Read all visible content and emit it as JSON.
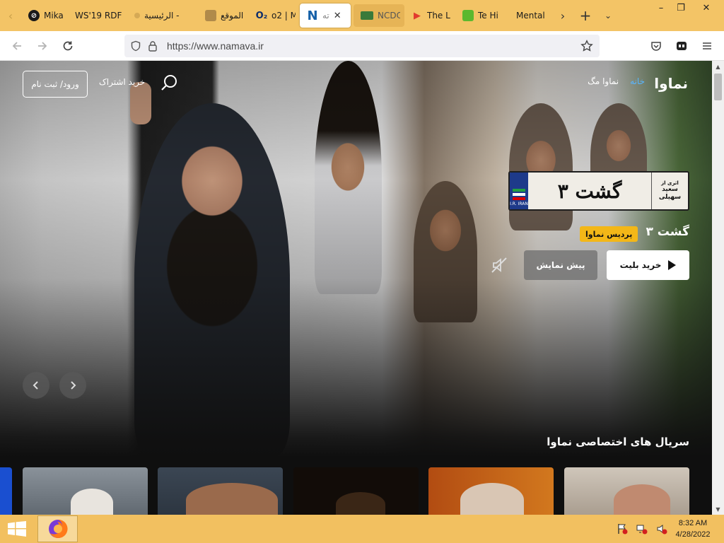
{
  "browser": {
    "tabs": [
      {
        "title": "Mikas",
        "favicon": "dark-circle-icon",
        "color": "#1a1a1a"
      },
      {
        "title": "WS'19 RDF",
        "favicon": "blank-icon",
        "color": "#f3c466"
      },
      {
        "title": "الرئيسية -",
        "favicon": "gray-dot-icon",
        "color": "#777777"
      },
      {
        "title": "الموقع",
        "favicon": "seal-icon",
        "color": "#8a6a3a"
      },
      {
        "title": "o2 | M",
        "favicon": "o2-icon",
        "color": "#0d2d6b"
      },
      {
        "title": "ته",
        "favicon": "namava-n-icon",
        "color": "#1560a8",
        "active": true
      },
      {
        "title": "NCDC",
        "favicon": "ncdc-icon",
        "color": "#3a7a3a",
        "highlight": true
      },
      {
        "title": "The L",
        "favicon": "play-red-icon",
        "color": "#e23b2e"
      },
      {
        "title": "Te Hi",
        "favicon": "green-leaf-icon",
        "color": "#5cb82e"
      },
      {
        "title": "Mental",
        "favicon": "none",
        "color": ""
      }
    ],
    "window_controls": {
      "minimize": "–",
      "restore": "❐",
      "close": "✕"
    },
    "address": {
      "url": "https://www.namava.ir",
      "scheme": "https://",
      "host": "www.namava.ir"
    }
  },
  "site": {
    "logo": "نماوا",
    "nav": [
      {
        "label": "خانه",
        "active": true
      },
      {
        "label": "نماوا مگ",
        "active": false
      }
    ],
    "subscribe_label": "خرید اشتراک",
    "login_label": "ورود/ ثبت نام",
    "accent": "#58b6ff"
  },
  "hero": {
    "logo_title": "گشت ۳",
    "logo_director_line1": "اثری از",
    "logo_director_line2": "سعید",
    "logo_director_line3": "سهیلی",
    "logo_country": "I.R. IRAN",
    "title": "گشت ۳",
    "badge": "پردیس نماوا",
    "badge_color": "#f3b718",
    "buy_ticket": "خرید بلیت",
    "preview": "پیش نمایش"
  },
  "section": {
    "title": "سریال های اختصاصی نماوا"
  },
  "taskbar": {
    "time": "8:32 AM",
    "date": "4/28/2022"
  }
}
